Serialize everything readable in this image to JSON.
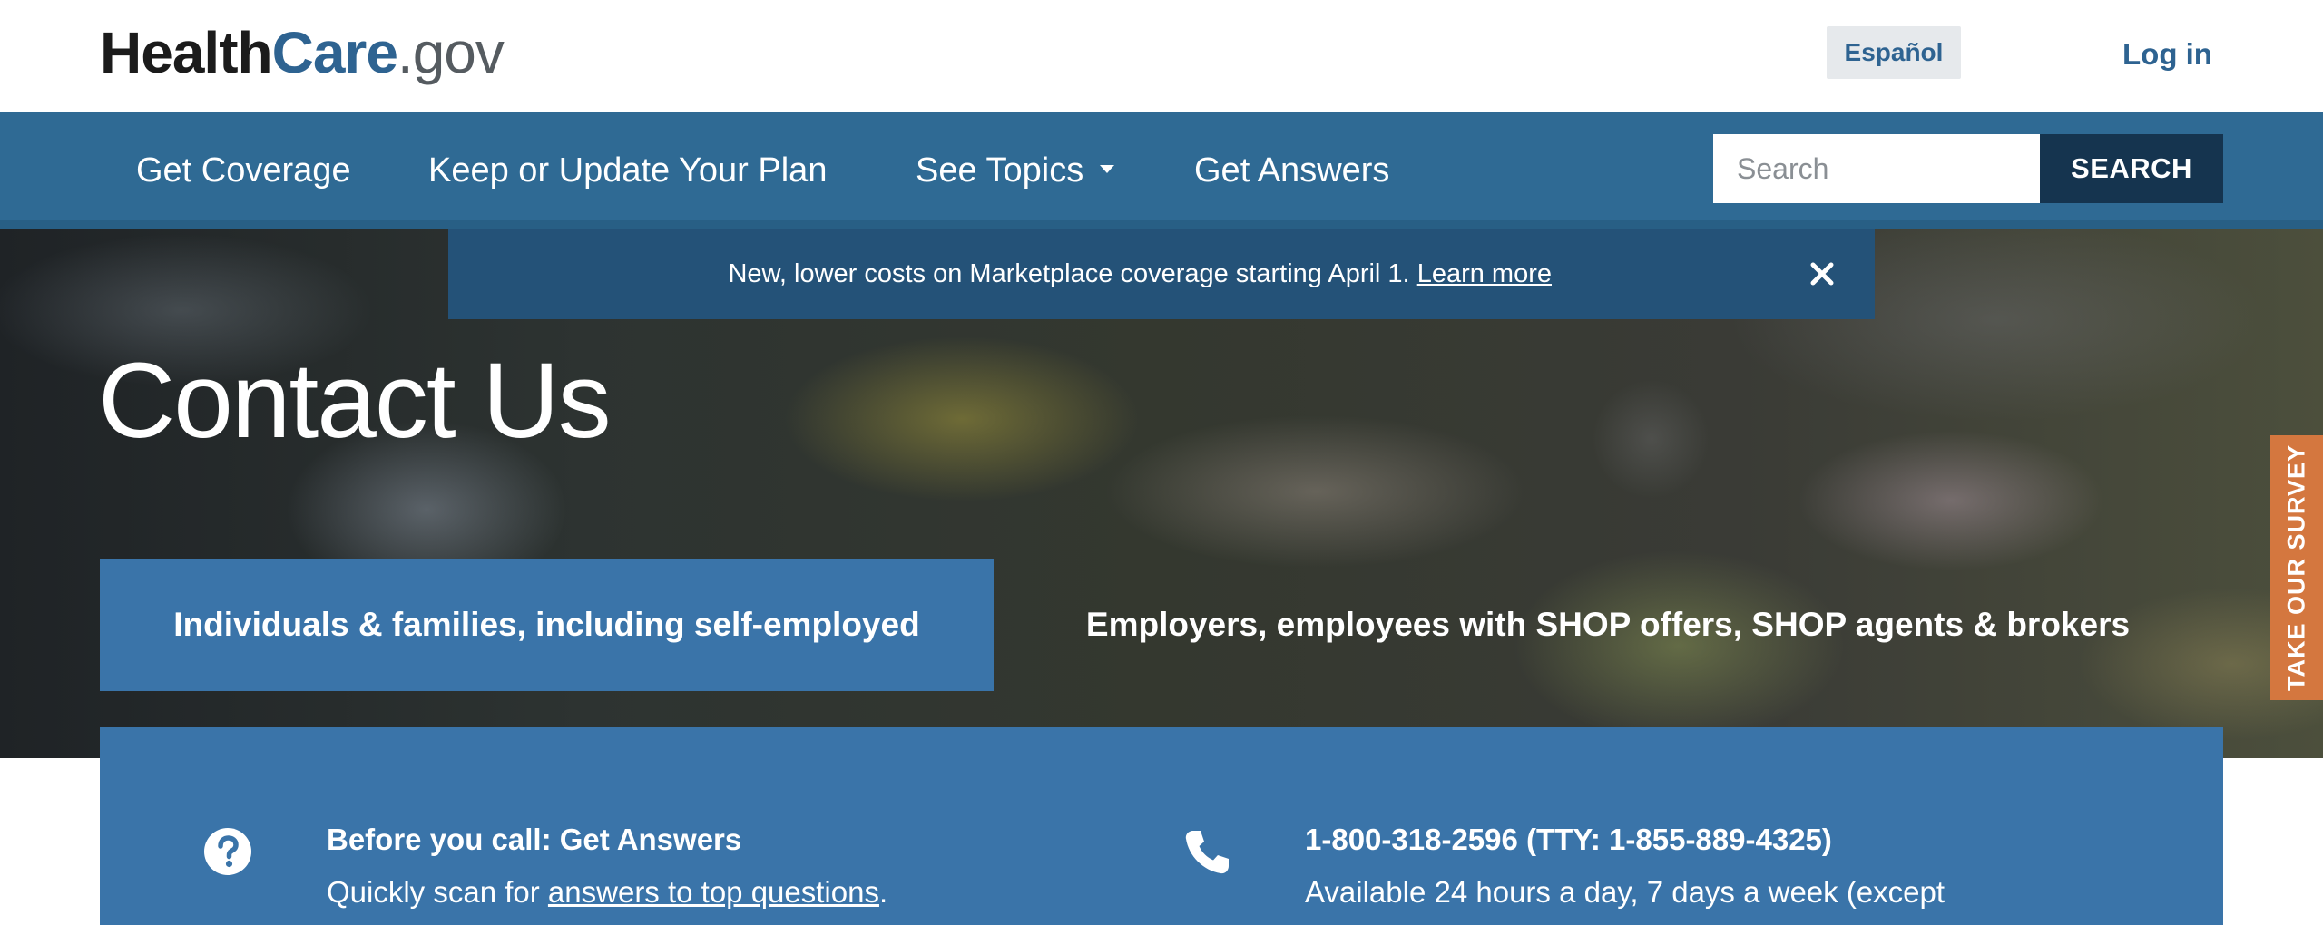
{
  "header": {
    "logo": {
      "part1": "Health",
      "part2": "Care",
      "part3": ".gov"
    },
    "espanol_label": "Español",
    "login_label": "Log in"
  },
  "nav": {
    "items": [
      {
        "label": "Get Coverage"
      },
      {
        "label": "Keep or Update Your Plan"
      },
      {
        "label": "See Topics"
      },
      {
        "label": "Get Answers"
      }
    ],
    "search": {
      "placeholder": "Search",
      "button_label": "SEARCH"
    }
  },
  "banner": {
    "text": "New, lower costs on Marketplace coverage starting April 1.",
    "link_label": "Learn more",
    "close_icon": "close-icon"
  },
  "hero": {
    "title": "Contact Us",
    "tabs": [
      {
        "label": "Individuals & families, including self-employed",
        "active": true
      },
      {
        "label": "Employers, employees with SHOP offers, SHOP agents & brokers",
        "active": false
      }
    ]
  },
  "survey": {
    "label": "TAKE OUR SURVEY"
  },
  "contact": {
    "left": {
      "icon": "question-circle-icon",
      "title": "Before you call: Get Answers",
      "text_before": "Quickly scan for",
      "link_label": "answers to top questions",
      "text_after": "."
    },
    "right": {
      "icon": "phone-icon",
      "title": "1-800-318-2596 (TTY: 1-855-889-4325)",
      "text": "Available 24 hours a day, 7 days a week (except"
    }
  },
  "colors": {
    "brand_blue": "#2e6391",
    "nav_bg": "#2f6a94",
    "banner_bg": "#245278",
    "panel_bg": "#3a74a9",
    "search_button_bg": "#15344f",
    "survey_bg": "#d4773f"
  }
}
